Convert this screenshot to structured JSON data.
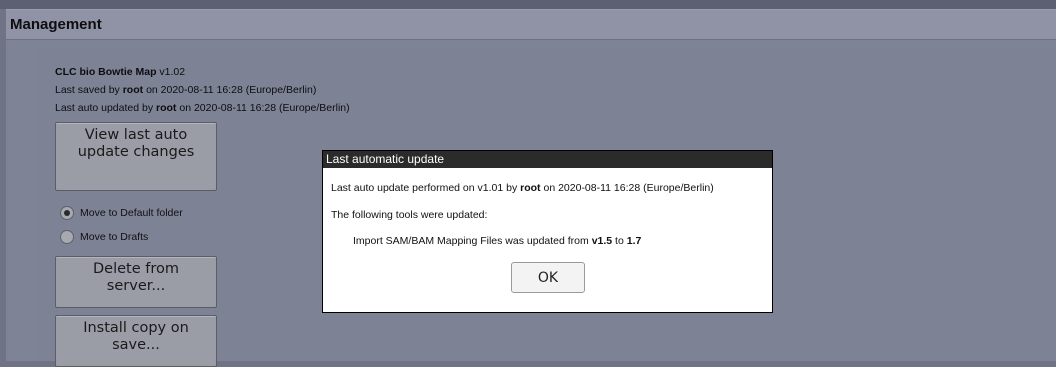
{
  "panel": {
    "title": "Management"
  },
  "workflow": {
    "name": "CLC bio Bowtie Map",
    "version": "v1.02",
    "saved_prefix": "Last saved by",
    "saved_user": "root",
    "saved_suffix": "on 2020-08-11 16:28 (Europe/Berlin)",
    "auto_prefix": "Last auto updated by",
    "auto_user": "root",
    "auto_suffix": "on 2020-08-11 16:28 (Europe/Berlin)"
  },
  "buttons": {
    "view_changes": "View last auto update changes",
    "delete": "Delete from server...",
    "install_copy": "Install copy on save..."
  },
  "radio_options": [
    {
      "label": "Move to Default folder",
      "checked": true
    },
    {
      "label": "Move to Drafts",
      "checked": false
    }
  ],
  "dialog": {
    "title": "Last automatic update",
    "line1_prefix": "Last auto update performed on v1.01 by",
    "line1_user": "root",
    "line1_suffix": "on 2020-08-11 16:28 (Europe/Berlin)",
    "line2": "The following tools were updated:",
    "line3_prefix": "Import SAM/BAM Mapping Files was updated from",
    "line3_from": "v1.5",
    "line3_mid": "to",
    "line3_to": "1.7",
    "ok_label": "OK"
  }
}
